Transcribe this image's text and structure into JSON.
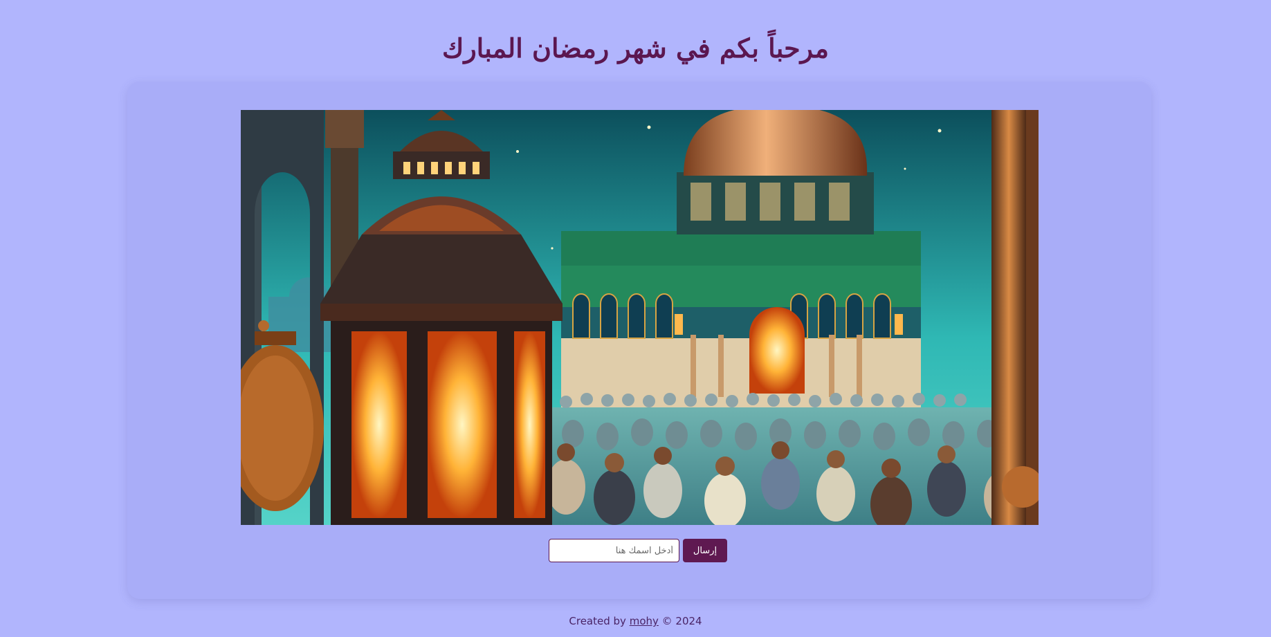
{
  "header": {
    "title": "مرحباً بكم في شهر رمضان المبارك"
  },
  "hero_image": {
    "icon": "ramadan-mosque-lantern-illustration"
  },
  "form": {
    "name_placeholder": "أدخل اسمك هنا",
    "submit_label": "إرسال"
  },
  "footer": {
    "prefix": "Created by ",
    "author": "mohy",
    "suffix": " © 2024"
  },
  "colors": {
    "background": "#b1b5fd",
    "title": "#5b1750",
    "button": "#5f1951"
  }
}
